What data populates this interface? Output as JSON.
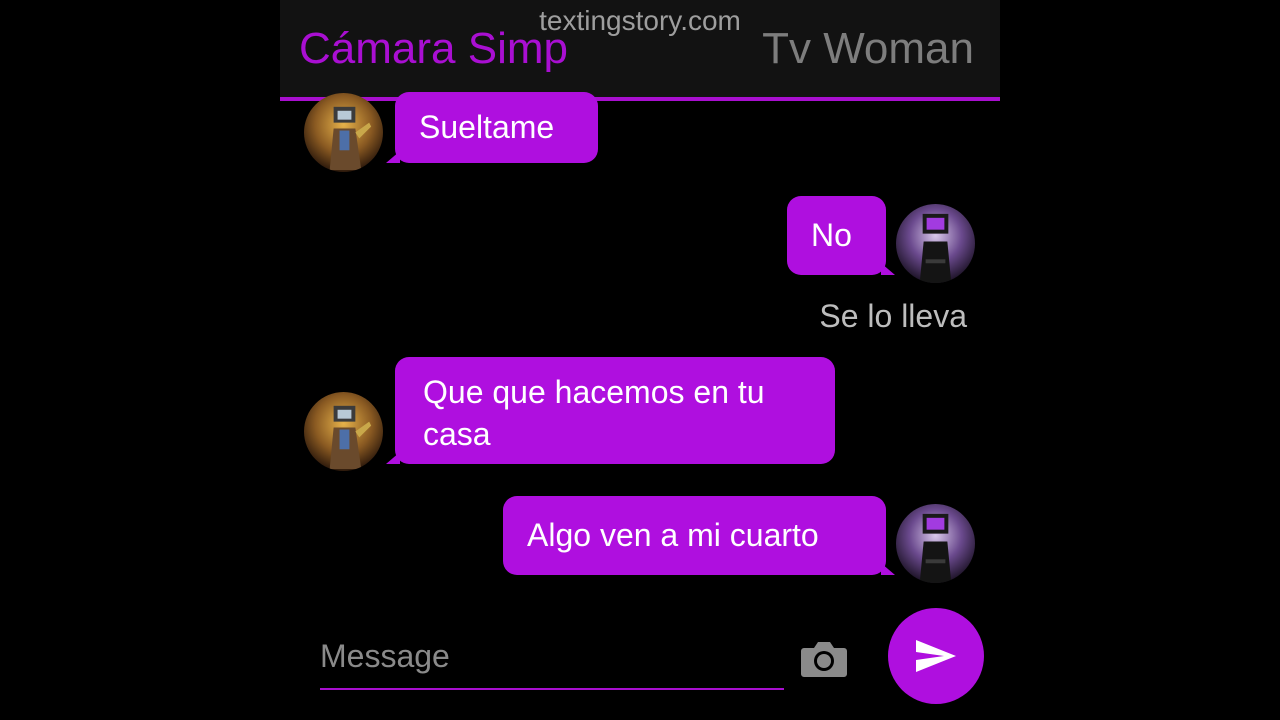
{
  "header": {
    "watermark": "textingstory.com",
    "left_contact": "Cámara Simp",
    "right_contact": "Tv Woman"
  },
  "messages": [
    {
      "side": "left",
      "text": "Sueltame"
    },
    {
      "side": "right",
      "text": "No"
    },
    {
      "side": "narration",
      "text": "Se lo lleva"
    },
    {
      "side": "left",
      "text": "Que que hacemos en tu casa"
    },
    {
      "side": "right",
      "text": "Algo ven a mi cuarto"
    }
  ],
  "composer": {
    "placeholder": "Message"
  },
  "icons": {
    "camera": "camera-icon",
    "send": "send-icon"
  },
  "colors": {
    "accent": "#af0fdf",
    "header_bg": "#121212",
    "left_name": "#a90fd2",
    "right_name": "#7d7d7d"
  }
}
